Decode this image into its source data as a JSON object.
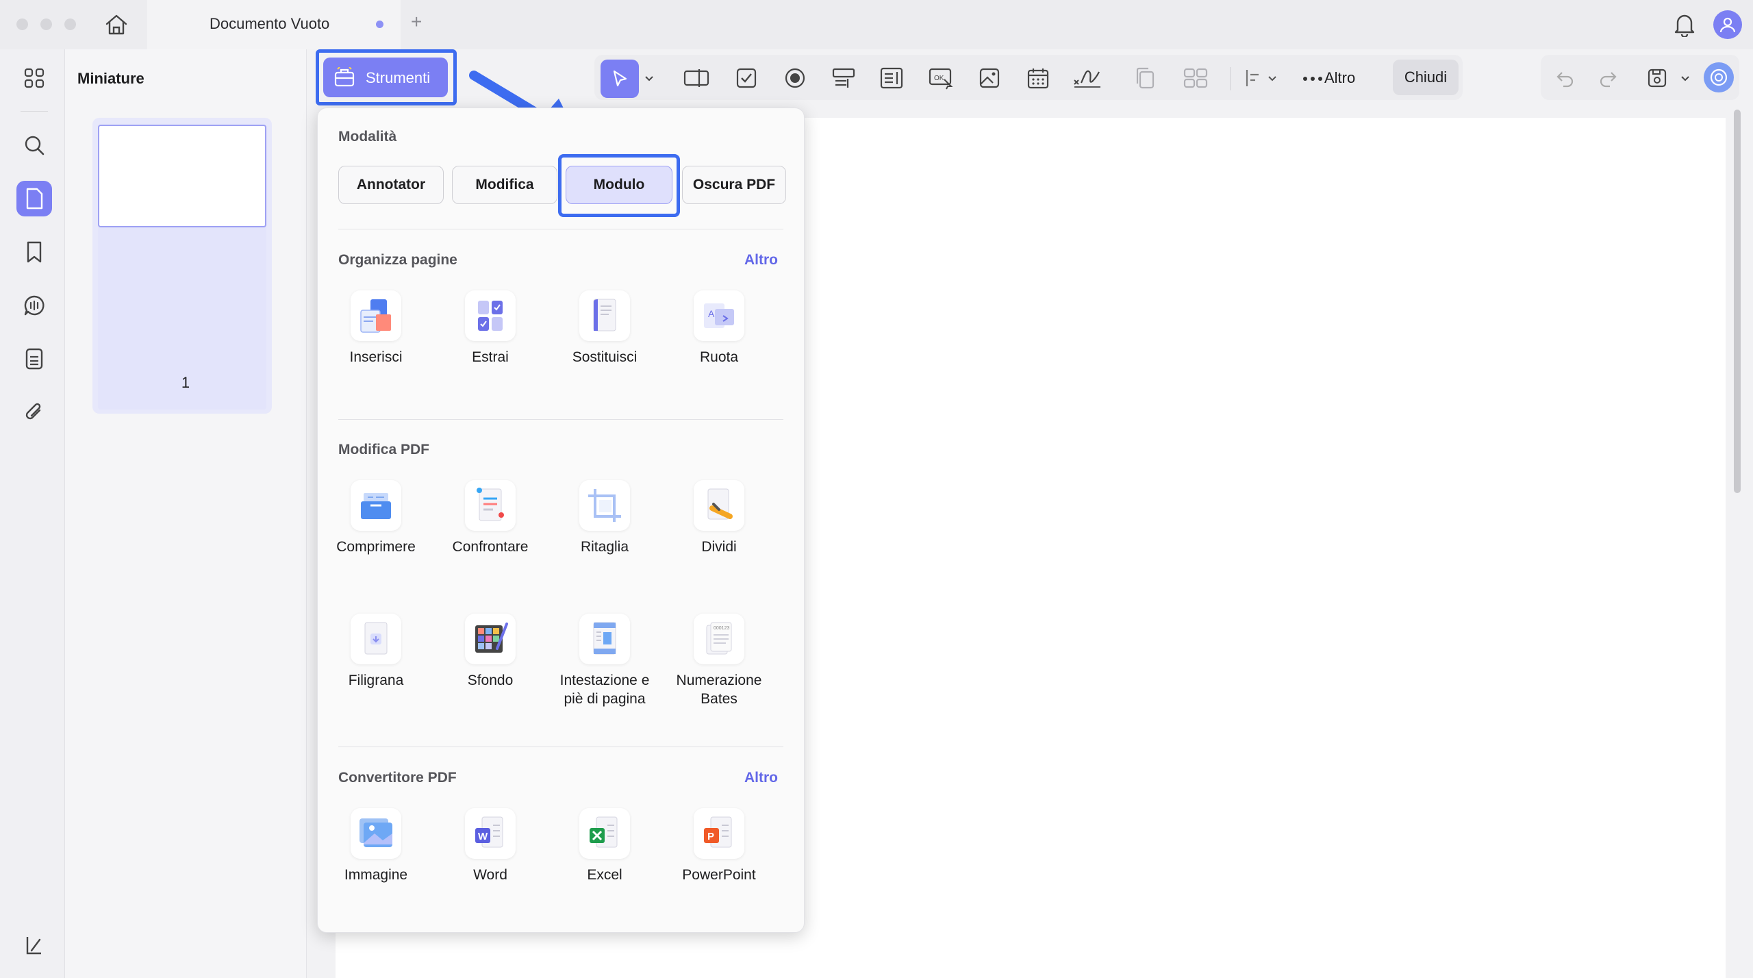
{
  "titlebar": {
    "tab_title": "Documento Vuoto",
    "new_tab": "+"
  },
  "thumbnails": {
    "title": "Miniature",
    "page_number": "1"
  },
  "toolbar": {
    "strumenti_label": "Strumenti",
    "altro_label": "Altro",
    "chiudi_label": "Chiudi"
  },
  "panel": {
    "modes_title": "Modalità",
    "modes": [
      "Annotator",
      "Modifica",
      "Modulo",
      "Oscura PDF"
    ],
    "selected_mode": "Modulo",
    "organize": {
      "title": "Organizza pagine",
      "more": "Altro",
      "tools": [
        "Inserisci",
        "Estrai",
        "Sostituisci",
        "Ruota"
      ]
    },
    "edit": {
      "title": "Modifica PDF",
      "tools": [
        "Comprimere",
        "Confrontare",
        "Ritaglia",
        "Dividi",
        "Filigrana",
        "Sfondo",
        "Intestazione e\npiè di pagina",
        "Numerazione\nBates"
      ]
    },
    "convert": {
      "title": "Convertitore PDF",
      "more": "Altro",
      "tools": [
        "Immagine",
        "Word",
        "Excel",
        "PowerPoint"
      ]
    }
  },
  "colors": {
    "accent": "#7b7ff3",
    "highlight_frame": "#3d6cf0",
    "link": "#6267e8"
  }
}
